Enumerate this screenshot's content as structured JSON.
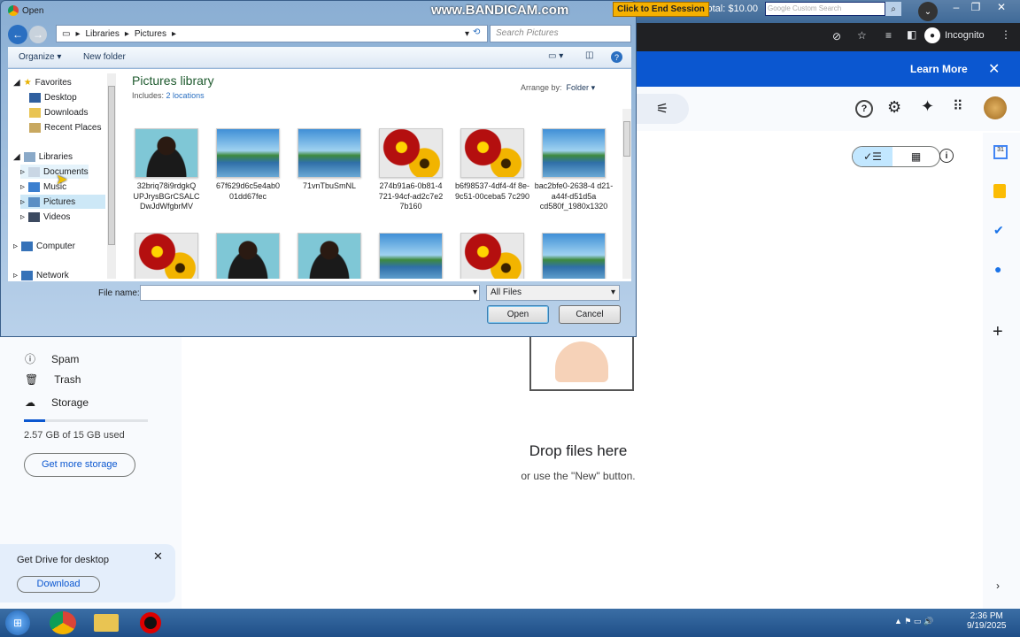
{
  "dialog": {
    "title": "Open",
    "breadcrumb": [
      "Libraries",
      "Pictures"
    ],
    "search_placeholder": "Search Pictures",
    "organize": "Organize",
    "new_folder": "New folder",
    "nav": {
      "favorites": "Favorites",
      "desktop": "Desktop",
      "downloads": "Downloads",
      "recent": "Recent Places",
      "libraries": "Libraries",
      "documents": "Documents",
      "music": "Music",
      "pictures": "Pictures",
      "videos": "Videos",
      "computer": "Computer",
      "network": "Network"
    },
    "library_title": "Pictures library",
    "includes_label": "Includes:",
    "includes_value": "2 locations",
    "arrange_label": "Arrange by:",
    "arrange_value": "Folder",
    "files": [
      {
        "name": "32briq78i9rdgkQ UPJrysBGrCSALC DwJdWfgbrMV",
        "thumb": "person"
      },
      {
        "name": "67f629d6c5e4ab0 01dd67fec",
        "thumb": "landscape"
      },
      {
        "name": "71vnTbuSmNL",
        "thumb": "landscape"
      },
      {
        "name": "274b91a6-0b81-4 721-94cf-ad2c7e2 7b160",
        "thumb": "flower"
      },
      {
        "name": "b6f98537-4df4-4f 8e-9c51-00ceba5 7c290",
        "thumb": "flower"
      },
      {
        "name": "bac2bfe0-2638-4 d21-a44f-d51d5a cd580f_1980x1320",
        "thumb": "landscape"
      }
    ],
    "filename_label": "File name:",
    "filename_value": "",
    "filter": "All Files",
    "open": "Open",
    "cancel": "Cancel"
  },
  "overlay": {
    "bandicam": "www.BANDICAM.com",
    "end_session": "Click to End Session",
    "total": "Total: $10.00",
    "custom_search": "Google Custom Search"
  },
  "chrome": {
    "incognito": "Incognito"
  },
  "drive": {
    "banner_learn_more": "Learn More",
    "nav": {
      "spam": "Spam",
      "trash": "Trash",
      "storage": "Storage"
    },
    "storage_used": "2.57 GB of 15 GB used",
    "storage_fraction": 0.17,
    "get_storage": "Get more storage",
    "promo_title": "Get Drive for desktop",
    "promo_download": "Download",
    "drop_title": "Drop files here",
    "drop_sub": "or use the \"New\" button."
  },
  "taskbar": {
    "time": "2:36 PM",
    "date": "9/19/2025"
  }
}
